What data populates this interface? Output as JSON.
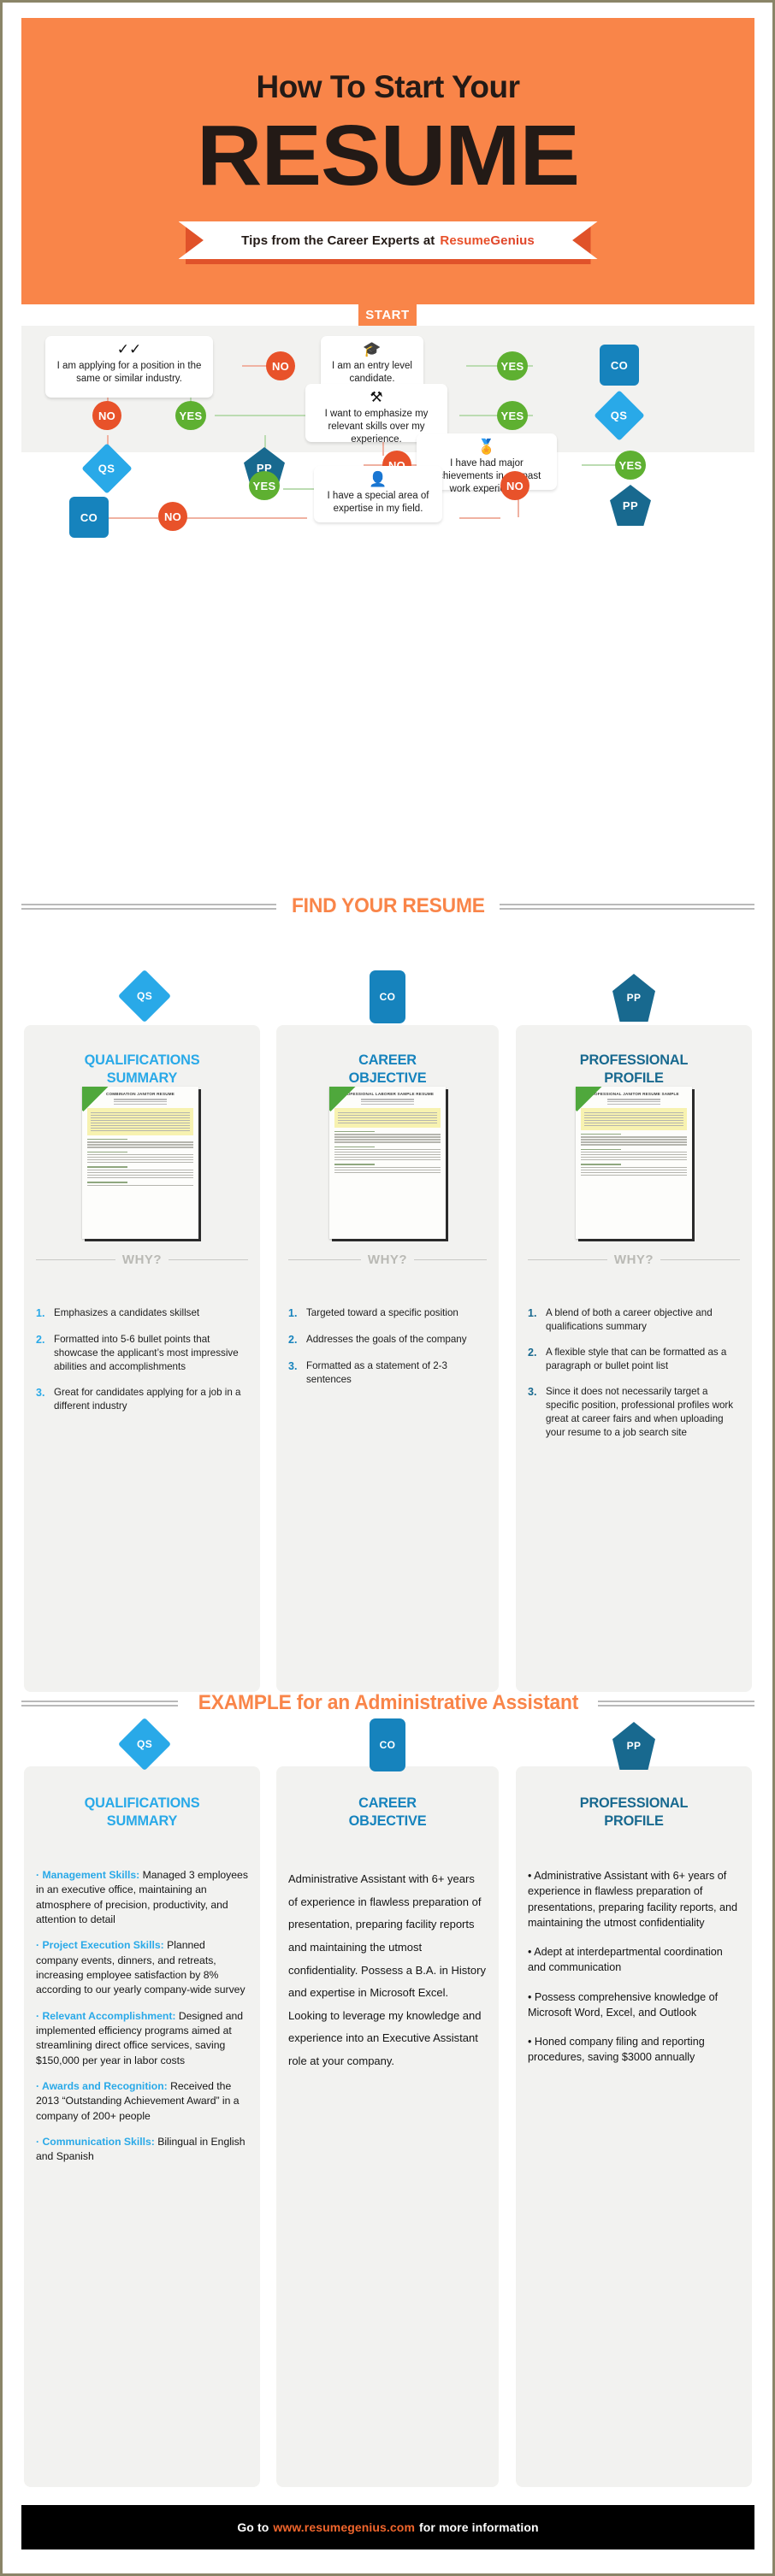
{
  "header": {
    "subtitle": "How To Start Your",
    "title": "RESUME",
    "ribbon_prefix": "Tips from the Career Experts at",
    "brand_first": "Resume",
    "brand_second": "Genius"
  },
  "flowchart": {
    "start_label": "START",
    "questions": [
      {
        "id": "q1",
        "icon": "checkmarks-icon",
        "text": "I am applying for a position in the same or similar industry."
      },
      {
        "id": "q2",
        "icon": "graduation-cap-icon",
        "text": "I am an entry level candidate."
      },
      {
        "id": "q3",
        "icon": "tools-icon",
        "text": "I want to emphasize my relevant skills over my experience."
      },
      {
        "id": "q4",
        "icon": "award-ribbon-icon",
        "text": "I have had major achievements in my past work experience."
      },
      {
        "id": "q5",
        "icon": "person-icon",
        "text": "I have a special area of expertise in my field."
      }
    ],
    "answer_no": "NO",
    "answer_yes": "YES",
    "results": {
      "qs": "QS",
      "co": "CO",
      "pp": "PP"
    }
  },
  "find_section": {
    "heading": "FIND YOUR RESUME",
    "why_label": "WHY?",
    "columns": [
      {
        "badge": "QS",
        "title_line1": "QUALIFICATIONS",
        "title_line2": "SUMMARY",
        "thumb_title": "COMBINATION JANITOR RESUME",
        "points": [
          "Emphasizes a candidates skillset",
          "Formatted into 5-6 bullet points that showcase the applicant’s most impressive abilities and accomplishments",
          "Great for candidates applying for a job in a different industry"
        ]
      },
      {
        "badge": "CO",
        "title_line1": "CAREER",
        "title_line2": "OBJECTIVE",
        "thumb_title": "PROFESSIONAL LABORER SAMPLE RESUME",
        "points": [
          "Targeted toward a specific position",
          "Addresses the goals of the company",
          "Formatted as a statement of 2-3 sentences"
        ]
      },
      {
        "badge": "PP",
        "title_line1": "PROFESSIONAL",
        "title_line2": "PROFILE",
        "thumb_title": "PROFESSIONAL JANITOR RESUME SAMPLE",
        "points": [
          "A blend of both a career objective and qualifications summary",
          "A flexible style that can be formatted as a paragraph or bullet point list",
          "Since it does not necessarily target a specific position, professional profiles work great at career fairs and when uploading your resume to a job search site"
        ]
      }
    ],
    "numbers": [
      "1.",
      "2.",
      "3."
    ]
  },
  "example_section": {
    "heading_bold": "EXAMPLE",
    "heading_rest": " for an Administrative Assistant",
    "columns": [
      {
        "badge": "QS",
        "title_line1": "QUALIFICATIONS",
        "title_line2": "SUMMARY",
        "bullets": [
          {
            "label": "· Management Skills:",
            "text": " Managed 3 employees in an executive office, maintaining an atmosphere of precision, productivity, and attention to detail"
          },
          {
            "label": "· Project Execution Skills:",
            "text": " Planned company events, dinners, and retreats, increasing employee satisfaction by 8% according to our yearly company-wide survey"
          },
          {
            "label": "· Relevant Accomplishment:",
            "text": " Designed and implemented efficiency programs aimed at streamlining direct office services, saving $150,000 per year in labor costs"
          },
          {
            "label": "· Awards and Recognition:",
            "text": " Received the 2013 “Outstanding Achievement Award” in a company of 200+ people"
          },
          {
            "label": "· Communication Skills:",
            "text": " Bilingual in English and Spanish"
          }
        ]
      },
      {
        "badge": "CO",
        "title_line1": "CAREER",
        "title_line2": "OBJECTIVE",
        "paragraph": "Administrative Assistant with 6+ years of experience in flawless preparation of presentation, preparing facility reports and maintaining the utmost confidentiality. Possess a B.A. in History and expertise in Microsoft Excel. Looking to leverage my knowledge and experience into an Executive Assistant role at your company."
      },
      {
        "badge": "PP",
        "title_line1": "PROFESSIONAL",
        "title_line2": "PROFILE",
        "bullets": [
          "• Administrative Assistant with 6+ years of experience in flawless preparation of presentations, preparing facility reports, and maintaining the utmost confidentiality",
          "• Adept at interdepartmental coordination and communication",
          "• Possess comprehensive knowledge of Microsoft Word, Excel, and Outlook",
          "• Honed company filing and reporting procedures, saving $3000 annually"
        ]
      }
    ]
  },
  "footer": {
    "prefix": "Go to",
    "url": "www.resumegenius.com",
    "suffix": "for more information"
  },
  "colors": {
    "orange": "#f98549",
    "orange_dark": "#e0522a",
    "red": "#e8522a",
    "green": "#5eb031",
    "blue_light": "#29a9e8",
    "blue_mid": "#1683bd",
    "blue_dark": "#18698f",
    "panel": "#f2f2f0",
    "ink": "#231a16"
  }
}
